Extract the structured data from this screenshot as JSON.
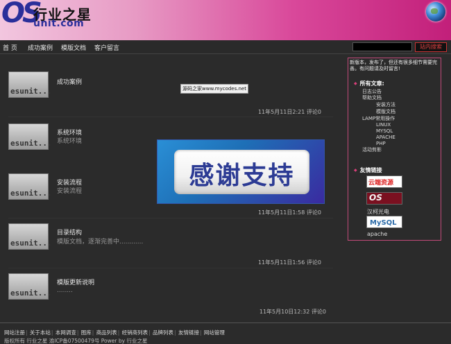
{
  "header": {
    "logo_os": "OS",
    "logo_cn": "行业之星",
    "logo_domain": "unit.com"
  },
  "nav": {
    "items": [
      "首 页",
      "成功案例",
      "模版文档",
      "客户留言"
    ],
    "search_button": "站内搜索"
  },
  "posts": [
    {
      "thumb": "esunit...",
      "title": "成功案例",
      "subtitle": "",
      "meta": "11年5月11日2:21 评论0"
    },
    {
      "thumb": "esunit...",
      "title": "系统环境",
      "subtitle": "系统环境",
      "meta": ""
    },
    {
      "thumb": "esunit...",
      "title": "安装流程",
      "subtitle": "安装流程",
      "meta": "11年5月11日1:58 评论0"
    },
    {
      "thumb": "esunit...",
      "title": "目录结构",
      "subtitle": "模版文档，逐渐完善中............",
      "meta": "11年5月11日1:56 评论0"
    },
    {
      "thumb": "esunit...",
      "title": "模版更新说明",
      "subtitle": "........",
      "meta": "11年5月10日12:32 评论0"
    }
  ],
  "watermark": "源码之家www.mycodes.net",
  "banner": {
    "text": "感谢支持"
  },
  "sidebar": {
    "notice": "新版本，发布了，但还有很多细节需要完善。有问题请及时留言!",
    "articles_title": "所有文章:",
    "categories": [
      {
        "label": "日志公告",
        "indent": 0
      },
      {
        "label": "帮助文档",
        "indent": 0
      },
      {
        "label": "安装方法",
        "indent": 2
      },
      {
        "label": "模版文档",
        "indent": 2
      },
      {
        "label": "LAMP常用操作",
        "indent": 0
      },
      {
        "label": "LINUX",
        "indent": 2
      },
      {
        "label": "MYSQL",
        "indent": 2
      },
      {
        "label": "APACHE",
        "indent": 2
      },
      {
        "label": "PHP",
        "indent": 2
      },
      {
        "label": "活动剪影",
        "indent": 0
      }
    ],
    "links_title": "友情链接",
    "links": [
      {
        "logo_text": "云端资源"
      },
      {
        "logo_text": "OS",
        "label": "汉柯光电"
      },
      {
        "logo_text": "MySQL",
        "label": "apache"
      }
    ]
  },
  "footer": {
    "links": [
      "网站注册",
      "关于本站",
      "本网调查",
      "图库",
      "商品列表",
      "经销商列表",
      "品牌列表",
      "友情链接",
      "网站管理"
    ],
    "copyright": "版权所有 行业之星 渝ICP备07500479号 Power by 行业之星"
  }
}
